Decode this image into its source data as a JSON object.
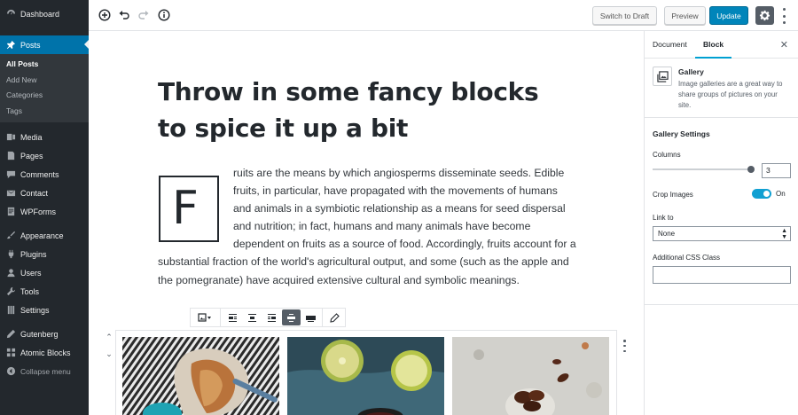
{
  "sidebar": {
    "dashboard": "Dashboard",
    "posts": "Posts",
    "posts_sub": [
      "All Posts",
      "Add New",
      "Categories",
      "Tags"
    ],
    "media": "Media",
    "pages": "Pages",
    "comments": "Comments",
    "contact": "Contact",
    "wpforms": "WPForms",
    "appearance": "Appearance",
    "plugins": "Plugins",
    "users": "Users",
    "tools": "Tools",
    "settings": "Settings",
    "gutenberg": "Gutenberg",
    "atomic_blocks": "Atomic Blocks",
    "collapse": "Collapse menu"
  },
  "toolbar": {
    "switch_to_draft": "Switch to Draft",
    "preview": "Preview",
    "update": "Update"
  },
  "editor": {
    "title": "Throw in some fancy blocks to spice it up a bit",
    "dropcap_letter": "F",
    "paragraph": "ruits are the means by which angiosperms disseminate seeds. Edible fruits, in particular, have propagated with the movements of humans and animals in a symbiotic relationship as a means for seed dispersal and nutrition; in fact, humans and many animals have become dependent on fruits as a source of food. Accordingly, fruits account for a substantial fraction of the world's agricultural output, and some (such as the apple and the pomegranate) have acquired extensive cultural and symbolic meanings."
  },
  "settings_panel": {
    "tabs": [
      "Document",
      "Block"
    ],
    "active_tab": "Block",
    "block_name": "Gallery",
    "block_description": "Image galleries are a great way to share groups of pictures on your site.",
    "section_title": "Gallery Settings",
    "columns_label": "Columns",
    "columns_value": "3",
    "crop_label": "Crop Images",
    "crop_state": "On",
    "link_label": "Link to",
    "link_value": "None",
    "css_class_label": "Additional CSS Class"
  },
  "colors": {
    "admin_bar": "#23282d",
    "accent": "#0073aa",
    "update_button": "#0085ba",
    "toggle_on": "#11a0d2"
  }
}
